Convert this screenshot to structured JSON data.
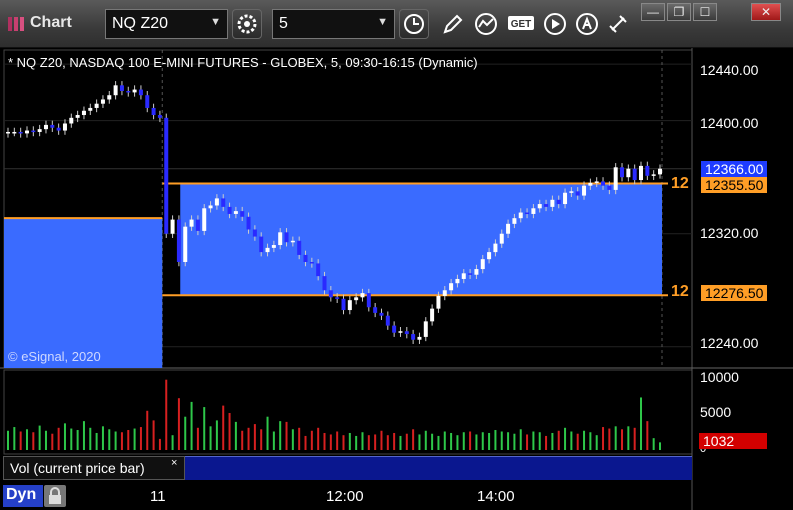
{
  "window": {
    "title": "Chart",
    "symbol_value": "NQ Z20",
    "interval_value": "5",
    "controls": {
      "minimize": "—",
      "restore": "❐",
      "maximize": "☐",
      "close": "✕"
    }
  },
  "toolbar_icons": [
    "settings-gear-icon",
    "clock-icon",
    "pencil-icon",
    "study-icon",
    "get-icon",
    "play-icon",
    "alert-icon",
    "link-icon"
  ],
  "colors": {
    "up_candle": "#ffffff",
    "down_candle": "#2a2aff",
    "range_fill": "#3a6bff",
    "range_line": "#ff9e26",
    "volume_up": "#2ec84a",
    "volume_down": "#d82020",
    "current_price": "#1e3cff"
  },
  "chart": {
    "header": "* NQ Z20, NASDAQ 100 E-MINI FUTURES - GLOBEX, 5, 09:30-16:15 (Dynamic)",
    "copyright": "© eSignal, 2020",
    "current_price": "12366.00",
    "range_high": "12355.50",
    "range_low": "12276.50",
    "range_marker": "12",
    "price_axis_labels": [
      "12440.00",
      "12400.00",
      "12320.00",
      "12240.00"
    ],
    "volume_axis_labels": [
      "10000",
      "5000",
      "0"
    ],
    "volume_value": "1032",
    "volume_legend": "Vol (current price bar)",
    "volume_close": "×",
    "mode_badge": "Dyn",
    "time_labels": [
      "11",
      "12:00",
      "14:00"
    ]
  },
  "chart_data": {
    "type": "candlestick",
    "price_axis": {
      "ylim": [
        12225,
        12450
      ],
      "ticks": [
        12240,
        12320,
        12400,
        12440
      ]
    },
    "volume_axis": {
      "ylim": [
        0,
        10000
      ],
      "ticks": [
        0,
        5000,
        10000
      ]
    },
    "opening_range": {
      "high": 12355.5,
      "low": 12276.5
    },
    "prior_session_range": {
      "high": 12331
    },
    "current_price": 12366.0,
    "current_volume": 1032,
    "closes": [
      12392,
      12392,
      12391,
      12393,
      12392,
      12394,
      12397,
      12395,
      12393,
      12398,
      12402,
      12404,
      12407,
      12409,
      12412,
      12415,
      12418,
      12425,
      12421,
      12420,
      12422,
      12418,
      12409,
      12404,
      12402,
      12320,
      12330,
      12300,
      12325,
      12330,
      12322,
      12338,
      12340,
      12345,
      12339,
      12334,
      12336,
      12332,
      12323,
      12318,
      12307,
      12310,
      12312,
      12321,
      12314,
      12315,
      12305,
      12300,
      12299,
      12290,
      12280,
      12275,
      12274,
      12266,
      12273,
      12275,
      12278,
      12268,
      12264,
      12262,
      12255,
      12250,
      12251,
      12249,
      12245,
      12247,
      12258,
      12267,
      12276,
      12280,
      12285,
      12288,
      12292,
      12291,
      12295,
      12302,
      12307,
      12313,
      12320,
      12327,
      12331,
      12335,
      12334,
      12338,
      12341,
      12339,
      12344,
      12341,
      12349,
      12350,
      12347,
      12354,
      12356,
      12357,
      12354,
      12351,
      12367,
      12360,
      12366,
      12358,
      12368,
      12361,
      12362,
      12366
    ],
    "volumes": [
      2600,
      3100,
      2500,
      2800,
      2400,
      3300,
      2600,
      2200,
      3000,
      3600,
      2900,
      2700,
      3900,
      3000,
      2300,
      3200,
      2800,
      2500,
      2400,
      2700,
      2900,
      3100,
      5300,
      4000,
      1500,
      9500,
      2000,
      7000,
      4500,
      6500,
      3000,
      5800,
      3200,
      4000,
      6000,
      5000,
      3800,
      2600,
      3000,
      3500,
      2800,
      4500,
      2500,
      3900,
      3800,
      2800,
      3000,
      1900,
      2600,
      3000,
      2300,
      2100,
      2500,
      2000,
      2300,
      1900,
      2400,
      2000,
      2100,
      2600,
      2000,
      2300,
      1900,
      2200,
      2800,
      2100,
      2600,
      2200,
      1900,
      2500,
      2300,
      2000,
      2400,
      2500,
      2100,
      2400,
      2300,
      2700,
      2500,
      2400,
      2200,
      2800,
      2100,
      2500,
      2400,
      1900,
      2300,
      2600,
      3000,
      2500,
      2200,
      2600,
      2400,
      2000,
      3100,
      2900,
      3200,
      2800,
      3200,
      3000,
      7100,
      3900,
      1600,
      1032
    ]
  }
}
